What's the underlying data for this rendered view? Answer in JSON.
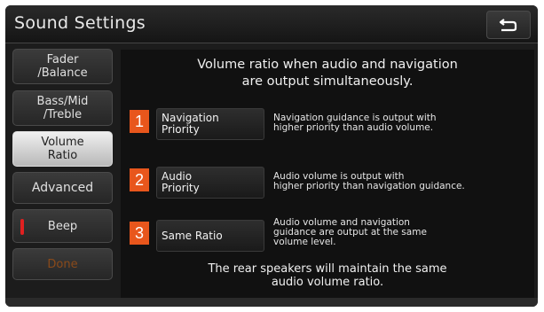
{
  "header": {
    "title": "Sound Settings"
  },
  "sidebar": {
    "items": [
      {
        "lines": [
          "Fader",
          "/Balance"
        ]
      },
      {
        "lines": [
          "Bass/Mid",
          "/Treble"
        ]
      },
      {
        "lines": [
          "Volume",
          "Ratio"
        ],
        "selected": true
      },
      {
        "lines": [
          "Advanced"
        ]
      },
      {
        "lines": [
          "Beep"
        ]
      },
      {
        "lines": [
          "Done"
        ]
      }
    ]
  },
  "main": {
    "heading_lines": [
      "Volume ratio when audio and navigation",
      "are output simultaneously."
    ],
    "options": [
      {
        "number": "1",
        "label_lines": [
          "Navigation",
          "Priority"
        ],
        "desc_lines": [
          "Navigation guidance is output with",
          "higher priority than audio volume."
        ]
      },
      {
        "number": "2",
        "label_lines": [
          "Audio",
          "Priority"
        ],
        "desc_lines": [
          "Audio volume is output with",
          "higher priority than navigation guidance."
        ]
      },
      {
        "number": "3",
        "label_lines": [
          "Same Ratio"
        ],
        "desc_lines": [
          "Audio volume and navigation",
          "guidance are output at the same",
          "volume level."
        ]
      }
    ],
    "footer_lines": [
      "The rear speakers will maintain the same",
      "audio volume ratio."
    ]
  },
  "colors": {
    "badge": "#e8561c",
    "selected": "#d9d9d9",
    "beep_led": "#e02020",
    "background": "#1c1c1c"
  },
  "icons": {
    "back": "back-arrow-icon"
  }
}
